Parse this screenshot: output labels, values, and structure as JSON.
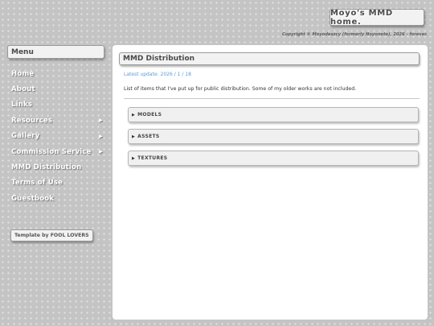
{
  "site": {
    "title": "Moyo's MMD home.",
    "copyright": "Copyright © Moyodeszcy (formerly Noyonete), 2026 - forever."
  },
  "sidebar": {
    "menu_title": "Menu",
    "items": [
      {
        "label": "Home",
        "has_submenu": false
      },
      {
        "label": "About",
        "has_submenu": false
      },
      {
        "label": "Links",
        "has_submenu": false
      },
      {
        "label": "Resources",
        "has_submenu": true
      },
      {
        "label": "Gallery",
        "has_submenu": true
      },
      {
        "label": "Commission Service",
        "has_submenu": true
      },
      {
        "label": "MMD Distribution",
        "has_submenu": false
      },
      {
        "label": "Terms of Use",
        "has_submenu": false
      },
      {
        "label": "Guestbook",
        "has_submenu": false
      }
    ],
    "submenu_icon": "chevron-right-icon",
    "credit": "Template by FOOL LOVERS"
  },
  "main": {
    "title": "MMD Distribution",
    "update": "Latest update: 2026 / 1 / 18",
    "intro": "List of items that I've put up for public distribution. Some of my older works are not included.",
    "sections": [
      {
        "label": "MODELS"
      },
      {
        "label": "ASSETS"
      },
      {
        "label": "TEXTURES"
      }
    ],
    "section_icon": "triangle-right-icon"
  },
  "colors": {
    "background": "#c4c4c4",
    "panel": "#ffffff",
    "accent_link": "#5b9bd5",
    "menu_text": "#ffffff"
  }
}
